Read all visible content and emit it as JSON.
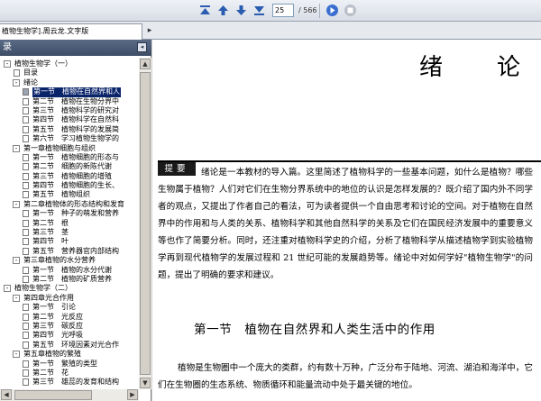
{
  "toolbar": {
    "current_page": "25",
    "total_pages": "/ 566",
    "buttons": [
      "first-page-icon",
      "prev-page-icon",
      "next-page-icon",
      "last-page-icon",
      "go-icon",
      "stop-icon"
    ]
  },
  "tab": {
    "title": "植物生物学].周云龙.文字版",
    "close": "▸"
  },
  "sidebar": {
    "header": "录",
    "collapse": "◂",
    "tree": [
      {
        "level": 0,
        "toggle": "-",
        "label": "植物生物学（一）"
      },
      {
        "level": 1,
        "toggle": "",
        "label": "目录"
      },
      {
        "level": 1,
        "toggle": "-",
        "label": "绪论"
      },
      {
        "level": 2,
        "toggle": "",
        "label": "第一节　植物在自然界和人",
        "selected": true
      },
      {
        "level": 2,
        "toggle": "",
        "label": "第二节　植物在生物分界中"
      },
      {
        "level": 2,
        "toggle": "",
        "label": "第三节　植物科学的研究对"
      },
      {
        "level": 2,
        "toggle": "",
        "label": "第四节　植物科学在自然科"
      },
      {
        "level": 2,
        "toggle": "",
        "label": "第五节　植物科学的发展简"
      },
      {
        "level": 2,
        "toggle": "",
        "label": "第六节　学习植物生物学的"
      },
      {
        "level": 1,
        "toggle": "-",
        "label": "第一章植物细胞与组织"
      },
      {
        "level": 2,
        "toggle": "",
        "label": "第一节　植物细胞的形态与"
      },
      {
        "level": 2,
        "toggle": "",
        "label": "第二节　细胞的新陈代谢"
      },
      {
        "level": 2,
        "toggle": "",
        "label": "第三节　植物细胞的增殖"
      },
      {
        "level": 2,
        "toggle": "",
        "label": "第四节　植物细胞的生长、"
      },
      {
        "level": 2,
        "toggle": "",
        "label": "第五节　植物组织"
      },
      {
        "level": 1,
        "toggle": "-",
        "label": "第二章植物体的形态结构和发育"
      },
      {
        "level": 2,
        "toggle": "",
        "label": "第一节　种子的萌发和营养"
      },
      {
        "level": 2,
        "toggle": "",
        "label": "第二节　根"
      },
      {
        "level": 2,
        "toggle": "",
        "label": "第三节　茎"
      },
      {
        "level": 2,
        "toggle": "",
        "label": "第四节　叶"
      },
      {
        "level": 2,
        "toggle": "",
        "label": "第五节　营养器官内部结构"
      },
      {
        "level": 1,
        "toggle": "-",
        "label": "第三章植物的水分营养"
      },
      {
        "level": 2,
        "toggle": "",
        "label": "第一节　植物的水分代谢"
      },
      {
        "level": 2,
        "toggle": "",
        "label": "第二节　植物的矿质营养"
      },
      {
        "level": 0,
        "toggle": "-",
        "label": "植物生物学（二）"
      },
      {
        "level": 1,
        "toggle": "-",
        "label": "第四章光合作用"
      },
      {
        "level": 2,
        "toggle": "",
        "label": "第一节　引论"
      },
      {
        "level": 2,
        "toggle": "",
        "label": "第二节　光反应"
      },
      {
        "level": 2,
        "toggle": "",
        "label": "第三节　碳反应"
      },
      {
        "level": 2,
        "toggle": "",
        "label": "第四节　光呼吸"
      },
      {
        "level": 2,
        "toggle": "",
        "label": "第五节　环境因素对光合作"
      },
      {
        "level": 1,
        "toggle": "-",
        "label": "第五章植物的繁殖"
      },
      {
        "level": 2,
        "toggle": "",
        "label": "第一节　繁殖的类型"
      },
      {
        "level": 2,
        "toggle": "",
        "label": "第二节　花"
      },
      {
        "level": 2,
        "toggle": "",
        "label": "第三节　雄蕊的发育和结构"
      }
    ]
  },
  "document": {
    "title": "绪论",
    "abstract_badge": "提要",
    "abstract": "绪论是一本教材的导入篇。这里简述了植物科学的一些基本问题，如什么是植物？哪些生物属于植物？人们对它们在生物分界系统中的地位的认识是怎样发展的？既介绍了国内外不同学者的观点，又提出了作者自己的看法，可为读者提供一个自由思考和讨论的空间。对于植物在自然界中的作用和与人类的关系、植物科学和其他自然科学的关系及它们在国民经济发展中的重要意义等也作了简要分析。同时，还注重对植物科学史的介绍，分析了植物科学从描述植物学到实验植物学再到现代植物学的发展过程和 21 世纪可能的发展趋势等。绪论中对如何学好\"植物生物学\"的问题，提出了明确的要求和建议。",
    "section_heading": "第一节　植物在自然界和人类生活中的作用",
    "body": "植物是生物圈中一个庞大的类群，约有数十万种，广泛分布于陆地、河流、湖泊和海洋中，它们在生物圈的生态系统、物质循环和能量流动中处于最关键的地位。"
  }
}
